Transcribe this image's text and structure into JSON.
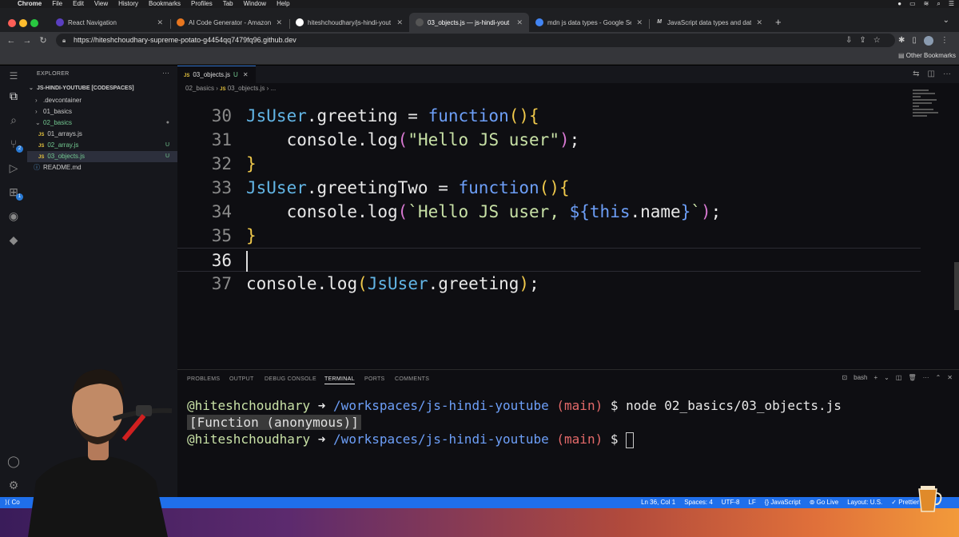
{
  "menubar": {
    "app": "Chrome",
    "items": [
      "File",
      "Edit",
      "View",
      "History",
      "Bookmarks",
      "Profiles",
      "Tab",
      "Window",
      "Help"
    ]
  },
  "browser": {
    "tabs": [
      {
        "title": "React Navigation",
        "icon": "react-nav-icon",
        "color": "#5a3fc0"
      },
      {
        "title": "AI Code Generator - Amazon C",
        "icon": "aws-icon",
        "color": "#e8761f"
      },
      {
        "title": "hiteshchoudhary/js-hindi-yout",
        "icon": "github-icon",
        "color": "#ffffff"
      },
      {
        "title": "03_objects.js — js-hindi-yout",
        "icon": "github-icon",
        "color": "#ffffff",
        "active": true
      },
      {
        "title": "mdn js data types - Google Se",
        "icon": "google-icon",
        "color": "#4285f4"
      },
      {
        "title": "JavaScript data types and data",
        "icon": "mdn-icon",
        "color": "#cccccc"
      }
    ],
    "new_tab": "+",
    "url": "https://hiteshchoudhary-supreme-potato-g4454qq7479fq96.github.dev",
    "bookmarks_other": "Other Bookmarks"
  },
  "explorer": {
    "title": "EXPLORER",
    "root": "JS-HINDI-YOUTUBE [CODESPACES]",
    "items": [
      {
        "label": ".devcontainer",
        "type": "folder",
        "open": false,
        "status": ""
      },
      {
        "label": "01_basics",
        "type": "folder",
        "open": false,
        "status": ""
      },
      {
        "label": "02_basics",
        "type": "folder",
        "open": true,
        "status": ""
      },
      {
        "label": "01_arrays.js",
        "type": "js",
        "status": ""
      },
      {
        "label": "02_array.js",
        "type": "js",
        "status": "U"
      },
      {
        "label": "03_objects.js",
        "type": "js",
        "status": "U"
      },
      {
        "label": "README.md",
        "type": "md",
        "status": ""
      }
    ]
  },
  "editor": {
    "tab_label": "03_objects.js",
    "tab_status": "U",
    "tab_badge": "JS",
    "breadcrumb": [
      "02_basics",
      "03_objects.js",
      "..."
    ],
    "lines": [
      {
        "n": "30",
        "tokens": [
          [
            "JsUser",
            "obj"
          ],
          [
            ".greeting = ",
            "pl"
          ],
          [
            "function",
            "kw"
          ],
          [
            "()",
            "br"
          ],
          [
            "{",
            "br"
          ]
        ]
      },
      {
        "n": "31",
        "tokens": [
          [
            "    console.",
            "pl"
          ],
          [
            "log",
            "pl"
          ],
          [
            "(",
            "br2"
          ],
          [
            "\"Hello JS user\"",
            "str"
          ],
          [
            ")",
            "br2"
          ],
          [
            ";",
            "pl"
          ]
        ]
      },
      {
        "n": "32",
        "tokens": [
          [
            "}",
            "br"
          ]
        ]
      },
      {
        "n": "33",
        "tokens": [
          [
            "JsUser",
            "obj"
          ],
          [
            ".greetingTwo = ",
            "pl"
          ],
          [
            "function",
            "kw"
          ],
          [
            "()",
            "br"
          ],
          [
            "{",
            "br"
          ]
        ]
      },
      {
        "n": "34",
        "tokens": [
          [
            "    console.",
            "pl"
          ],
          [
            "log",
            "pl"
          ],
          [
            "(",
            "br2"
          ],
          [
            "`Hello JS user, ",
            "str"
          ],
          [
            "${",
            "kw"
          ],
          [
            "this",
            "this"
          ],
          [
            ".name",
            "pl"
          ],
          [
            "}",
            "kw"
          ],
          [
            "`",
            "str"
          ],
          [
            ")",
            "br2"
          ],
          [
            ";",
            "pl"
          ]
        ]
      },
      {
        "n": "35",
        "tokens": [
          [
            "}",
            "br"
          ]
        ]
      },
      {
        "n": "36",
        "tokens": [],
        "current": true
      },
      {
        "n": "37",
        "tokens": [
          [
            "console.",
            "pl"
          ],
          [
            "log",
            "pl"
          ],
          [
            "(",
            "br"
          ],
          [
            "JsUser",
            "obj"
          ],
          [
            ".greeting",
            "pl"
          ],
          [
            ")",
            "br"
          ],
          [
            ";",
            "pl"
          ]
        ]
      }
    ]
  },
  "panel": {
    "tabs": [
      "PROBLEMS",
      "OUTPUT",
      "DEBUG CONSOLE",
      "TERMINAL",
      "PORTS",
      "COMMENTS"
    ],
    "active_tab": "TERMINAL",
    "shell": "bash",
    "terminal": {
      "user": "@hiteshchoudhary",
      "arrow": "➜",
      "path": "/workspaces/js-hindi-youtube",
      "branch": "(main)",
      "prompt": "$",
      "command": "node 02_basics/03_objects.js",
      "output": "[Function (anonymous)]"
    }
  },
  "statusbar": {
    "left": "Co",
    "items": [
      "Ln 36, Col 1",
      "Spaces: 4",
      "UTF-8",
      "LF",
      "{} JavaScript",
      "Go Live",
      "Layout: U.S.",
      "Prettier"
    ]
  }
}
